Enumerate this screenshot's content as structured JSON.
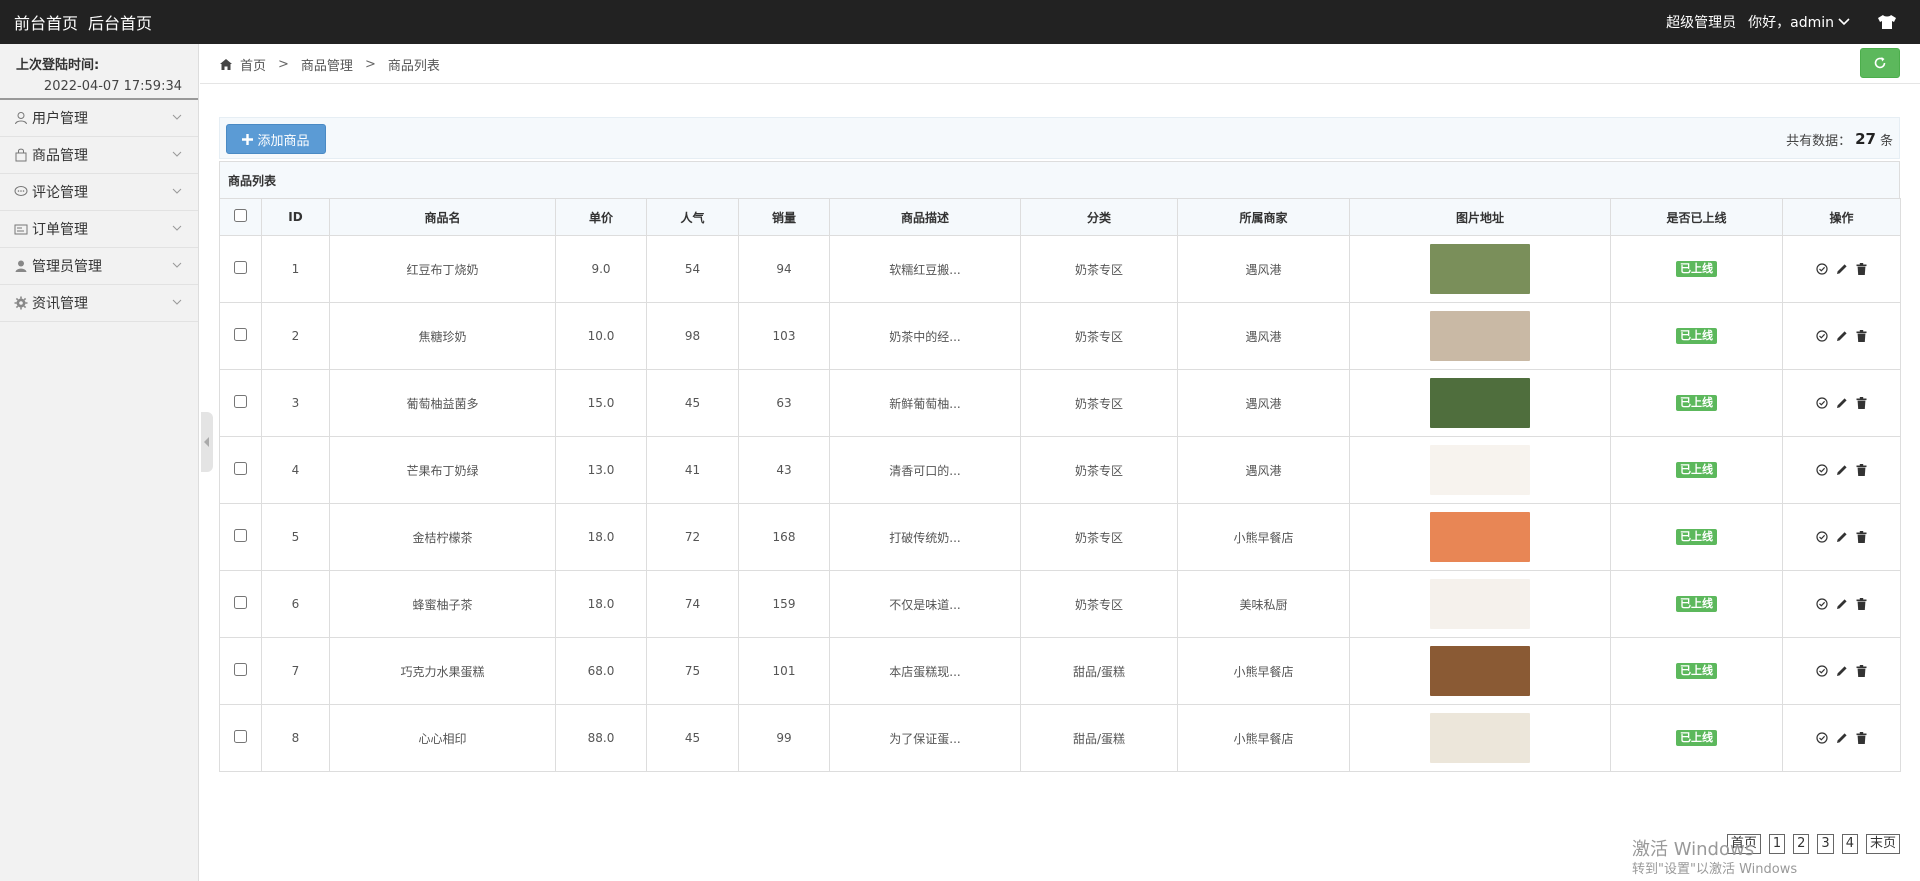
{
  "topbar": {
    "front_home": "前台首页",
    "back_home": "后台首页",
    "role": "超级管理员",
    "greeting": "你好，admin"
  },
  "sidebar": {
    "last_login_label": "上次登陆时间:",
    "last_login_time": "2022-04-07 17:59:34",
    "items": [
      {
        "label": "用户管理",
        "icon": "user-icon"
      },
      {
        "label": "商品管理",
        "icon": "bag-icon"
      },
      {
        "label": "评论管理",
        "icon": "comment-icon"
      },
      {
        "label": "订单管理",
        "icon": "order-icon"
      },
      {
        "label": "管理员管理",
        "icon": "admin-icon"
      },
      {
        "label": "资讯管理",
        "icon": "gear-icon"
      }
    ]
  },
  "breadcrumb": {
    "home": "首页",
    "level1": "商品管理",
    "level2": "商品列表",
    "sep": ">"
  },
  "toolbar": {
    "add_label": "添加商品",
    "count_prefix": "共有数据：",
    "count_value": "27",
    "count_suffix": "条"
  },
  "table": {
    "caption": "商品列表",
    "headers": [
      "ID",
      "商品名",
      "单价",
      "人气",
      "销量",
      "商品描述",
      "分类",
      "所属商家",
      "图片地址",
      "是否已上线",
      "操作"
    ],
    "rows": [
      {
        "id": "1",
        "name": "红豆布丁烧奶",
        "price": "9.0",
        "popularity": "54",
        "sales": "94",
        "desc": "软糯红豆搬...",
        "category": "奶茶专区",
        "merchant": "遇风港",
        "status": "已上线",
        "thumb_color": "#7a8f5a"
      },
      {
        "id": "2",
        "name": "焦糖珍奶",
        "price": "10.0",
        "popularity": "98",
        "sales": "103",
        "desc": "奶茶中的经...",
        "category": "奶茶专区",
        "merchant": "遇风港",
        "status": "已上线",
        "thumb_color": "#c9b9a5"
      },
      {
        "id": "3",
        "name": "葡萄柚益菌多",
        "price": "15.0",
        "popularity": "45",
        "sales": "63",
        "desc": "新鲜葡萄柚...",
        "category": "奶茶专区",
        "merchant": "遇风港",
        "status": "已上线",
        "thumb_color": "#4f6e3d"
      },
      {
        "id": "4",
        "name": "芒果布丁奶绿",
        "price": "13.0",
        "popularity": "41",
        "sales": "43",
        "desc": "清香可口的...",
        "category": "奶茶专区",
        "merchant": "遇风港",
        "status": "已上线",
        "thumb_color": "#f7f3ee"
      },
      {
        "id": "5",
        "name": "金桔柠檬茶",
        "price": "18.0",
        "popularity": "72",
        "sales": "168",
        "desc": "打破传统奶...",
        "category": "奶茶专区",
        "merchant": "小熊早餐店",
        "status": "已上线",
        "thumb_color": "#e88655"
      },
      {
        "id": "6",
        "name": "蜂蜜柚子茶",
        "price": "18.0",
        "popularity": "74",
        "sales": "159",
        "desc": "不仅是味道...",
        "category": "奶茶专区",
        "merchant": "美味私厨",
        "status": "已上线",
        "thumb_color": "#f5f1ec"
      },
      {
        "id": "7",
        "name": "巧克力水果蛋糕",
        "price": "68.0",
        "popularity": "75",
        "sales": "101",
        "desc": "本店蛋糕现...",
        "category": "甜品/蛋糕",
        "merchant": "小熊早餐店",
        "status": "已上线",
        "thumb_color": "#8a5a34"
      },
      {
        "id": "8",
        "name": "心心相印",
        "price": "88.0",
        "popularity": "45",
        "sales": "99",
        "desc": "为了保证蛋...",
        "category": "甜品/蛋糕",
        "merchant": "小熊早餐店",
        "status": "已上线",
        "thumb_color": "#ece6da"
      }
    ]
  },
  "pager": {
    "first": "首页",
    "pages": [
      "1",
      "2",
      "3",
      "4"
    ],
    "last": "末页"
  },
  "watermark": {
    "line1": "激活 Windows",
    "line2": "转到\"设置\"以激活 Windows"
  }
}
